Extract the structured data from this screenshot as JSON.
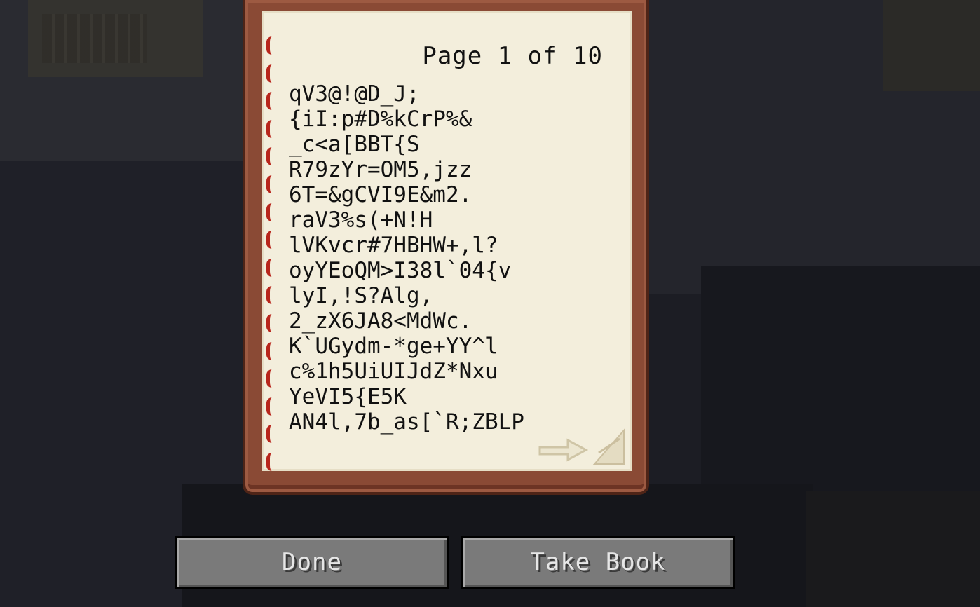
{
  "book": {
    "page_indicator": "Page 1 of 10",
    "lines": [
      "qV3@!@D_J;",
      "{iI:p#D%kCrP%&",
      "_c<a[BBT{S",
      "R79zYr=OM5,jzz",
      "6T=&gCVI9E&m2.",
      "raV3%s(+N!H",
      "lVKvcr#7HBHW+,l?",
      "oyYEoQM>I38l`04{v",
      "lyI,!S?Alg,",
      "2_zX6JA8<MdWc.",
      "K`UGydm-*ge+YY^l",
      "c%1h5UiUIJdZ*Nxu",
      "YeVI5{E5K",
      "AN4l,7b_as[`R;ZBLP"
    ],
    "next_page_icon": "arrow-right-icon"
  },
  "buttons": {
    "done_label": "Done",
    "take_label": "Take Book"
  },
  "colors": {
    "page": "#f3eedc",
    "cover": "#8a4a35",
    "binding": "#b8261c",
    "button": "#7a7a7a"
  }
}
